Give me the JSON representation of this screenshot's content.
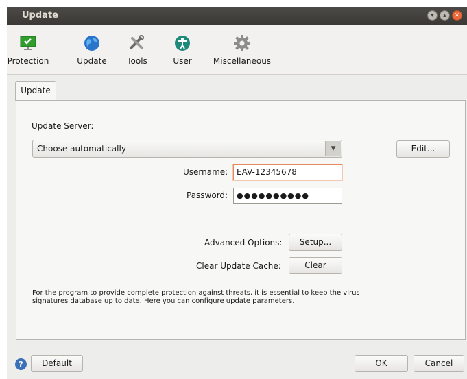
{
  "window": {
    "title": "Update"
  },
  "toolbar": {
    "items": [
      {
        "label": "Protection",
        "icon": "monitor-check-icon"
      },
      {
        "label": "Update",
        "icon": "globe-icon"
      },
      {
        "label": "Tools",
        "icon": "tools-icon"
      },
      {
        "label": "User",
        "icon": "user-accessibility-icon"
      },
      {
        "label": "Miscellaneous",
        "icon": "gear-icon"
      }
    ]
  },
  "tab": {
    "label": "Update"
  },
  "form": {
    "update_server_label": "Update Server:",
    "server_selected": "Choose automatically",
    "edit_button": "Edit...",
    "username_label": "Username:",
    "username_value": "EAV-12345678",
    "password_label": "Password:",
    "password_mask": "●●●●●●●●●●",
    "advanced_label": "Advanced Options:",
    "setup_button": "Setup...",
    "clear_cache_label": "Clear Update Cache:",
    "clear_button": "Clear",
    "info_line1": "For the program to provide complete protection against threats, it is essential to keep the virus",
    "info_line2": "signatures database up to date. Here you can configure update parameters."
  },
  "footer": {
    "help": "?",
    "default_button": "Default",
    "ok_button": "OK",
    "cancel_button": "Cancel"
  },
  "colors": {
    "accent": "#e8683a",
    "titlebar": "#3c3b37",
    "focus_border": "#e08a5e"
  }
}
